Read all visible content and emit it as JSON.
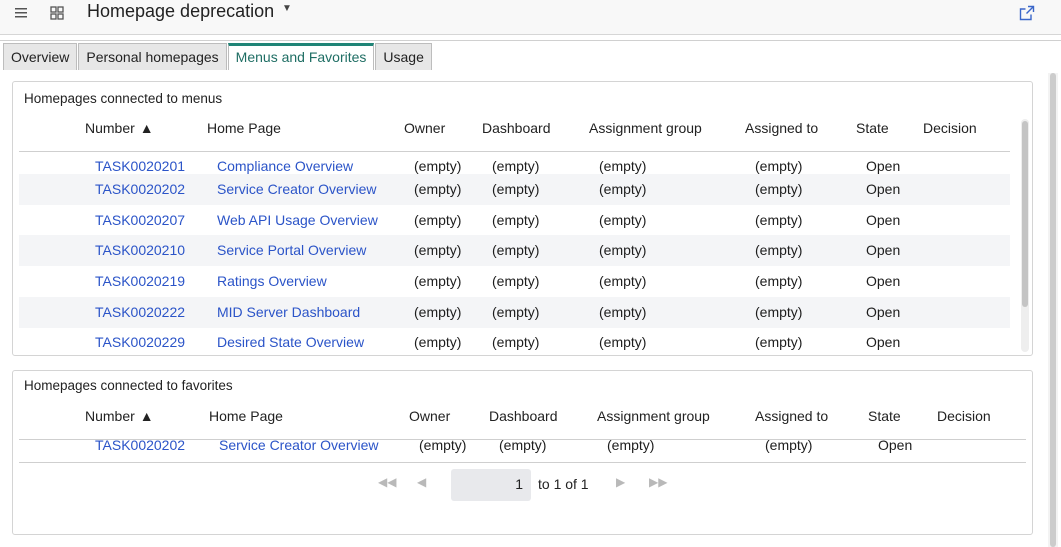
{
  "header": {
    "title": "Homepage deprecation"
  },
  "tabs": [
    {
      "label": "Overview"
    },
    {
      "label": "Personal homepages"
    },
    {
      "label": "Menus and Favorites",
      "active": true
    },
    {
      "label": "Usage"
    }
  ],
  "columns": {
    "number": "Number",
    "home_page": "Home Page",
    "owner": "Owner",
    "dashboard": "Dashboard",
    "assignment_group": "Assignment group",
    "assigned_to": "Assigned to",
    "state": "State",
    "decision": "Decision"
  },
  "menus": {
    "title": "Homepages connected to menus",
    "rows": [
      {
        "number": "TASK0020201",
        "home_page": "Compliance Overview",
        "owner": "(empty)",
        "dashboard": "(empty)",
        "assignment_group": "(empty)",
        "assigned_to": "(empty)",
        "state": "Open"
      },
      {
        "number": "TASK0020202",
        "home_page": "Service Creator Overview",
        "owner": "(empty)",
        "dashboard": "(empty)",
        "assignment_group": "(empty)",
        "assigned_to": "(empty)",
        "state": "Open"
      },
      {
        "number": "TASK0020207",
        "home_page": "Web API Usage Overview",
        "owner": "(empty)",
        "dashboard": "(empty)",
        "assignment_group": "(empty)",
        "assigned_to": "(empty)",
        "state": "Open"
      },
      {
        "number": "TASK0020210",
        "home_page": "Service Portal Overview",
        "owner": "(empty)",
        "dashboard": "(empty)",
        "assignment_group": "(empty)",
        "assigned_to": "(empty)",
        "state": "Open"
      },
      {
        "number": "TASK0020219",
        "home_page": "Ratings Overview",
        "owner": "(empty)",
        "dashboard": "(empty)",
        "assignment_group": "(empty)",
        "assigned_to": "(empty)",
        "state": "Open"
      },
      {
        "number": "TASK0020222",
        "home_page": "MID Server Dashboard",
        "owner": "(empty)",
        "dashboard": "(empty)",
        "assignment_group": "(empty)",
        "assigned_to": "(empty)",
        "state": "Open"
      },
      {
        "number": "TASK0020229",
        "home_page": "Desired State Overview",
        "owner": "(empty)",
        "dashboard": "(empty)",
        "assignment_group": "(empty)",
        "assigned_to": "(empty)",
        "state": "Open"
      }
    ]
  },
  "favorites": {
    "title": "Homepages connected to favorites",
    "rows": [
      {
        "number": "TASK0020202",
        "home_page": "Service Creator Overview",
        "owner": "(empty)",
        "dashboard": "(empty)",
        "assignment_group": "(empty)",
        "assigned_to": "(empty)",
        "state": "Open"
      }
    ]
  },
  "pagination": {
    "current_page": "1",
    "summary": "to 1 of 1"
  },
  "icons": {
    "menu": "hamburger-icon",
    "apps": "grid-icon",
    "title_dropdown": "caret-down-icon",
    "popout": "open-in-new-window-icon",
    "first": "double-chevron-left-icon",
    "prev": "chevron-left-icon",
    "next": "chevron-right-icon",
    "last": "double-chevron-right-icon"
  },
  "colors": {
    "link": "#2b54c8",
    "active_tab_accent": "#1f8476",
    "alt_row": "#f4f5f7"
  }
}
